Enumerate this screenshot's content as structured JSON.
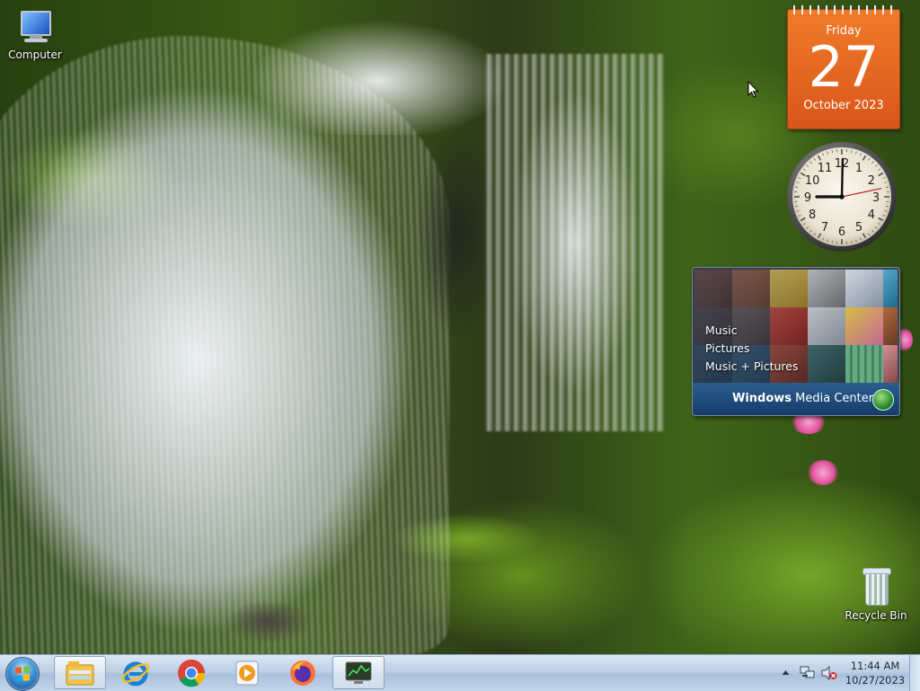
{
  "desktop": {
    "icons": [
      {
        "label": "Computer",
        "icon": "computer-icon"
      },
      {
        "label": "Recycle Bin",
        "icon": "recycle-bin-icon"
      }
    ]
  },
  "gadgets": {
    "calendar": {
      "weekday": "Friday",
      "day": "27",
      "month_year": "October 2023"
    },
    "clock": {
      "hour": 9,
      "minute": 0,
      "second": 13,
      "numerals": [
        "12",
        "1",
        "2",
        "3",
        "4",
        "5",
        "6",
        "7",
        "8",
        "9",
        "10",
        "11"
      ]
    },
    "media_center": {
      "menu": [
        "Music",
        "Pictures",
        "Music + Pictures"
      ],
      "brand_bold": "Windows",
      "brand_rest": " Media Center"
    }
  },
  "taskbar": {
    "start": "start-orb",
    "pinned": [
      {
        "name": "file-explorer-icon",
        "active": true
      },
      {
        "name": "internet-explorer-icon",
        "active": false
      },
      {
        "name": "chrome-icon",
        "active": false
      },
      {
        "name": "media-player-icon",
        "active": false
      },
      {
        "name": "firefox-icon",
        "active": false
      },
      {
        "name": "system-monitor-icon",
        "active": true
      }
    ],
    "tray": {
      "time": "11:44 AM",
      "date": "10/27/2023"
    }
  },
  "colors": {
    "calendar_orange": "#e8661f",
    "media_center_blue": "#1f4b7a",
    "taskbar_blue": "#bcd0e6"
  }
}
